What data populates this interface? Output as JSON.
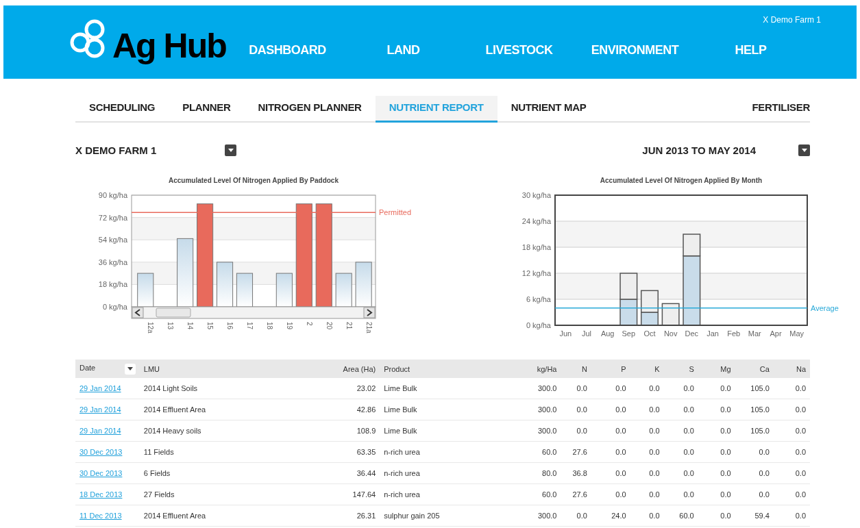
{
  "header": {
    "logo": "Ag Hub",
    "user": "X Demo Farm 1",
    "nav": [
      "DASHBOARD",
      "LAND",
      "LIVESTOCK",
      "ENVIRONMENT",
      "HELP"
    ]
  },
  "tabs": [
    {
      "label": "SCHEDULING",
      "selected": false
    },
    {
      "label": "PLANNER",
      "selected": false
    },
    {
      "label": "NITROGEN PLANNER",
      "selected": false
    },
    {
      "label": "NUTRIENT REPORT",
      "selected": true
    },
    {
      "label": "NUTRIENT MAP",
      "selected": false
    },
    {
      "label": "FERTILISER",
      "selected": false
    }
  ],
  "filters": {
    "farm": "X DEMO FARM 1",
    "period": "JUN 2013 TO MAY 2014"
  },
  "paddock_chart": {
    "chart_data": {
      "type": "bar",
      "title": "Accumulated Level Of Nitrogen Applied By Paddock",
      "categories": [
        "12a",
        "13",
        "14",
        "15",
        "16",
        "17",
        "18",
        "19",
        "2",
        "20",
        "21",
        "21a"
      ],
      "values": [
        27,
        0,
        55,
        83,
        36,
        27,
        0,
        27,
        83,
        83,
        27,
        36
      ],
      "ylim": [
        0,
        90
      ],
      "yticks": [
        {
          "value": 0,
          "label": "0 kg/ha"
        },
        {
          "value": 18,
          "label": "18 kg/ha"
        },
        {
          "value": 36,
          "label": "36 kg/ha"
        },
        {
          "value": 54,
          "label": "54 kg/ha"
        },
        {
          "value": 72,
          "label": "72 kg/ha"
        },
        {
          "value": 90,
          "label": "90 kg/ha"
        }
      ],
      "grid": true,
      "ref_lines": [
        {
          "axis": "y",
          "value": 76,
          "label": "Permitted",
          "color": "#e86a5c"
        }
      ]
    }
  },
  "month_chart": {
    "chart_data": {
      "type": "bar",
      "stacked": true,
      "title": "Accumulated Level Of Nitrogen Applied By Month",
      "categories": [
        "Jun",
        "Jul",
        "Aug",
        "Sep",
        "Oct",
        "Nov",
        "Dec",
        "Jan",
        "Feb",
        "Mar",
        "Apr",
        "May"
      ],
      "series": [
        {
          "color": "#c9dcea",
          "values": [
            0,
            0,
            0,
            6,
            3,
            0,
            16,
            0,
            0,
            0,
            0,
            0
          ]
        },
        {
          "color": "#eeeeee",
          "values": [
            0,
            0,
            0,
            6,
            5,
            5,
            5,
            0,
            0,
            0,
            0,
            0
          ]
        }
      ],
      "ylim": [
        0,
        30
      ],
      "yticks": [
        {
          "value": 0,
          "label": "0 kg/ha"
        },
        {
          "value": 6,
          "label": "6 kg/ha"
        },
        {
          "value": 12,
          "label": "12 kg/ha"
        },
        {
          "value": 18,
          "label": "18 kg/ha"
        },
        {
          "value": 24,
          "label": "24 kg/ha"
        },
        {
          "value": 30,
          "label": "30 kg/ha"
        }
      ],
      "grid": true,
      "ref_lines": [
        {
          "axis": "y",
          "value": 4,
          "label": "Average",
          "color": "#29a9d8"
        }
      ]
    }
  },
  "table": {
    "columns": [
      {
        "label": "Date",
        "kind": "date",
        "sorted": true
      },
      {
        "label": "LMU",
        "kind": "text",
        "sorted": false
      },
      {
        "label": "Area (Ha)",
        "kind": "number",
        "sorted": false
      },
      {
        "label": "Product",
        "kind": "text",
        "sorted": false
      },
      {
        "label": "kg/Ha",
        "kind": "number",
        "sorted": false
      },
      {
        "label": "N",
        "kind": "number",
        "sorted": false
      },
      {
        "label": "P",
        "kind": "number",
        "sorted": false
      },
      {
        "label": "K",
        "kind": "number",
        "sorted": false
      },
      {
        "label": "S",
        "kind": "number",
        "sorted": false
      },
      {
        "label": "Mg",
        "kind": "number",
        "sorted": false
      },
      {
        "label": "Ca",
        "kind": "number",
        "sorted": false
      },
      {
        "label": "Na",
        "kind": "number",
        "sorted": false
      }
    ],
    "rows": [
      [
        "29 Jan 2014",
        "2014 Light Soils",
        "23.02",
        "Lime Bulk",
        "300.0",
        "0.0",
        "0.0",
        "0.0",
        "0.0",
        "0.0",
        "105.0",
        "0.0"
      ],
      [
        "29 Jan 2014",
        "2014 Effluent Area",
        "42.86",
        "Lime Bulk",
        "300.0",
        "0.0",
        "0.0",
        "0.0",
        "0.0",
        "0.0",
        "105.0",
        "0.0"
      ],
      [
        "29 Jan 2014",
        "2014 Heavy soils",
        "108.9",
        "Lime Bulk",
        "300.0",
        "0.0",
        "0.0",
        "0.0",
        "0.0",
        "0.0",
        "105.0",
        "0.0"
      ],
      [
        "30 Dec 2013",
        "11 Fields",
        "63.35",
        "n-rich urea",
        "60.0",
        "27.6",
        "0.0",
        "0.0",
        "0.0",
        "0.0",
        "0.0",
        "0.0"
      ],
      [
        "30 Dec 2013",
        "6 Fields",
        "36.44",
        "n-rich urea",
        "80.0",
        "36.8",
        "0.0",
        "0.0",
        "0.0",
        "0.0",
        "0.0",
        "0.0"
      ],
      [
        "18 Dec 2013",
        "27 Fields",
        "147.64",
        "n-rich urea",
        "60.0",
        "27.6",
        "0.0",
        "0.0",
        "0.0",
        "0.0",
        "0.0",
        "0.0"
      ],
      [
        "11 Dec 2013",
        "2014 Effluent Area",
        "26.31",
        "sulphur gain 205",
        "300.0",
        "0.0",
        "24.0",
        "0.0",
        "60.0",
        "0.0",
        "59.4",
        "0.0"
      ]
    ]
  }
}
